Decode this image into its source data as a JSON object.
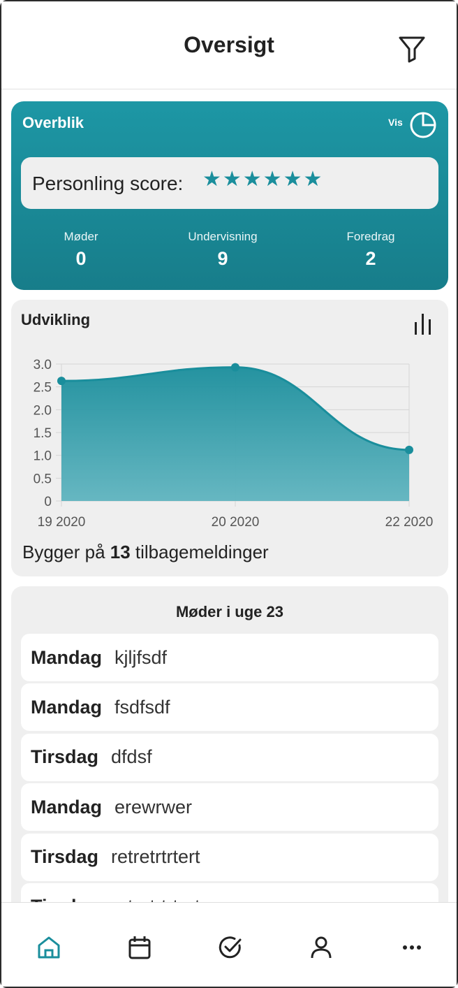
{
  "header": {
    "title": "Oversigt"
  },
  "overview": {
    "title": "Overblik",
    "vis_label": "Vis",
    "score_label": "Personling score:",
    "stars": "★★★★★★",
    "stats": [
      {
        "label": "Møder",
        "value": "0"
      },
      {
        "label": "Undervisning",
        "value": "9"
      },
      {
        "label": "Foredrag",
        "value": "2"
      }
    ]
  },
  "development": {
    "title": "Udvikling",
    "footer_prefix": "Bygger på ",
    "footer_count": "13",
    "footer_suffix": " tilbagemeldinger"
  },
  "chart_data": {
    "type": "area",
    "x": [
      "19 2020",
      "20 2020",
      "22 2020"
    ],
    "series": [
      {
        "values": [
          2.63,
          2.93,
          1.12
        ]
      }
    ],
    "yticks": [
      "3.0",
      "2.5",
      "2.0",
      "1.5",
      "1.0",
      "0.5",
      "0"
    ],
    "ylim": [
      0,
      3
    ],
    "grid": true,
    "colors": {
      "line": "#1a8e9c",
      "fill_top": "#1a8e9c",
      "fill_bottom": "#5fb4bf"
    }
  },
  "meetings": {
    "title": "Møder i uge 23",
    "items": [
      {
        "day": "Mandag",
        "name": "kjljfsdf"
      },
      {
        "day": "Mandag",
        "name": "fsdfsdf"
      },
      {
        "day": "Tirsdag",
        "name": "dfdsf"
      },
      {
        "day": "Mandag",
        "name": "erewrwer"
      },
      {
        "day": "Tirsdag",
        "name": "retretrtrtert"
      },
      {
        "day": "Tirsdag",
        "name": "retretrtrtert"
      }
    ]
  },
  "nav": {
    "active_color": "#1a8e9c",
    "icons": [
      "home-icon",
      "calendar-icon",
      "check-circle-icon",
      "user-icon",
      "more-icon"
    ]
  }
}
